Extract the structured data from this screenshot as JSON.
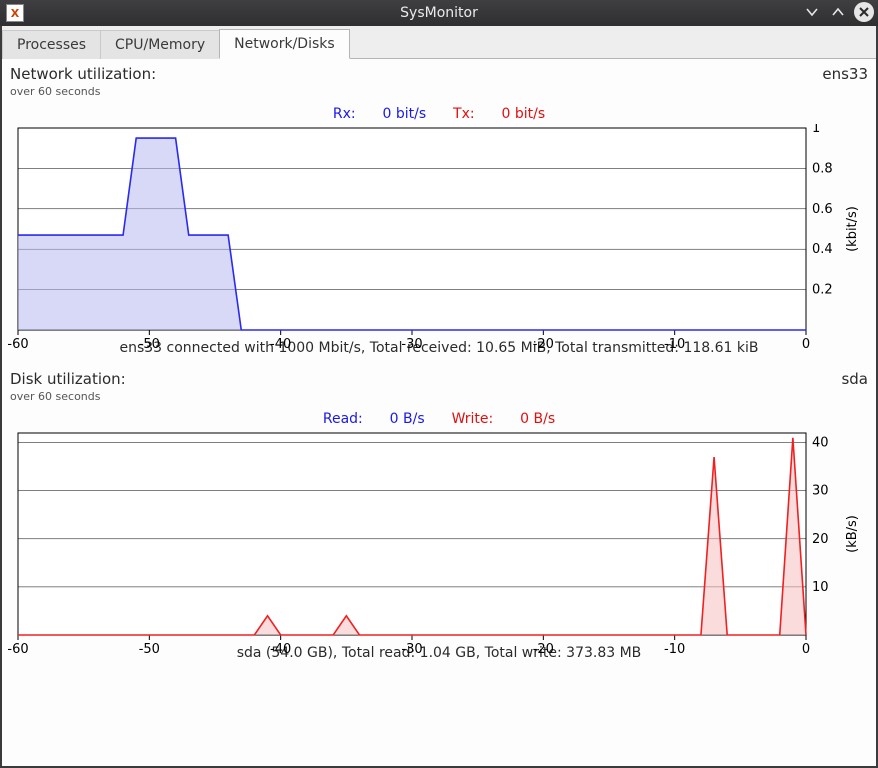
{
  "window": {
    "title": "SysMonitor",
    "app_icon_letter": "X"
  },
  "tabs": {
    "items": [
      {
        "label": "Processes",
        "active": false
      },
      {
        "label": "CPU/Memory",
        "active": false
      },
      {
        "label": "Network/Disks",
        "active": true
      }
    ]
  },
  "network": {
    "title": "Network utilization:",
    "device": "ens33",
    "subtitle": "over 60 seconds",
    "legend": {
      "rx_label": "Rx:",
      "rx_value": "0  bit/s",
      "tx_label": "Tx:",
      "tx_value": "0  bit/s"
    },
    "ylabel": "(kbit/s)",
    "caption": "ens33 connected with 1000 Mbit/s, Total received: 10.65 MiB, Total transmitted: 118.61 kiB"
  },
  "disk": {
    "title": "Disk utilization:",
    "device": "sda",
    "subtitle": "over 60 seconds",
    "legend": {
      "read_label": "Read:",
      "read_value": "0  B/s",
      "write_label": "Write:",
      "write_value": "0  B/s"
    },
    "ylabel": "(kB/s)",
    "caption": "sda (54.0 GB), Total read: 1.04 GB, Total write: 373.83 MB"
  },
  "chart_data": [
    {
      "id": "network",
      "type": "area",
      "x": [
        -60,
        -59,
        -58,
        -57,
        -56,
        -55,
        -54,
        -53,
        -52,
        -51,
        -50,
        -49,
        -48,
        -47,
        -46,
        -45,
        -44,
        -43,
        -42,
        -41,
        -40,
        -39,
        -38,
        -37,
        -36,
        -35,
        -34,
        -33,
        -32,
        -31,
        -30,
        -29,
        -28,
        -27,
        -26,
        -25,
        -24,
        -23,
        -22,
        -21,
        -20,
        -19,
        -18,
        -17,
        -16,
        -15,
        -14,
        -13,
        -12,
        -11,
        -10,
        -9,
        -8,
        -7,
        -6,
        -5,
        -4,
        -3,
        -2,
        -1,
        0
      ],
      "xlabel": "",
      "ylabel": "(kbit/s)",
      "xlim": [
        -60,
        0
      ],
      "ylim": [
        0,
        1.0
      ],
      "xticks": [
        -60,
        -50,
        -40,
        -30,
        -20,
        -10,
        0
      ],
      "yticks": [
        0.2,
        0.4,
        0.6,
        0.8,
        1.0
      ],
      "series": [
        {
          "name": "Rx",
          "color": "#2a2af0",
          "fill": "#b8b8f0",
          "values": [
            0.47,
            0.47,
            0.47,
            0.47,
            0.47,
            0.47,
            0.47,
            0.47,
            0.47,
            0.95,
            0.95,
            0.95,
            0.95,
            0.47,
            0.47,
            0.47,
            0.47,
            0,
            0,
            0,
            0,
            0,
            0,
            0,
            0,
            0,
            0,
            0,
            0,
            0,
            0,
            0,
            0,
            0,
            0,
            0,
            0,
            0,
            0,
            0,
            0,
            0,
            0,
            0,
            0,
            0,
            0,
            0,
            0,
            0,
            0,
            0,
            0,
            0,
            0,
            0,
            0,
            0,
            0,
            0,
            0
          ]
        },
        {
          "name": "Tx",
          "color": "#f02020",
          "fill": "#f6c0c0",
          "values": [
            0,
            0,
            0,
            0,
            0,
            0,
            0,
            0,
            0,
            0,
            0,
            0,
            0,
            0,
            0,
            0,
            0,
            0,
            0,
            0,
            0,
            0,
            0,
            0,
            0,
            0,
            0,
            0,
            0,
            0,
            0,
            0,
            0,
            0,
            0,
            0,
            0,
            0,
            0,
            0,
            0,
            0,
            0,
            0,
            0,
            0,
            0,
            0,
            0,
            0,
            0,
            0,
            0,
            0,
            0,
            0,
            0,
            0,
            0,
            0,
            0
          ]
        }
      ]
    },
    {
      "id": "disk",
      "type": "area",
      "x": [
        -60,
        -59,
        -58,
        -57,
        -56,
        -55,
        -54,
        -53,
        -52,
        -51,
        -50,
        -49,
        -48,
        -47,
        -46,
        -45,
        -44,
        -43,
        -42,
        -41,
        -40,
        -39,
        -38,
        -37,
        -36,
        -35,
        -34,
        -33,
        -32,
        -31,
        -30,
        -29,
        -28,
        -27,
        -26,
        -25,
        -24,
        -23,
        -22,
        -21,
        -20,
        -19,
        -18,
        -17,
        -16,
        -15,
        -14,
        -13,
        -12,
        -11,
        -10,
        -9,
        -8,
        -7,
        -6,
        -5,
        -4,
        -3,
        -2,
        -1,
        0
      ],
      "xlabel": "",
      "ylabel": "(kB/s)",
      "xlim": [
        -60,
        0
      ],
      "ylim": [
        0,
        42
      ],
      "xticks": [
        -60,
        -50,
        -40,
        -30,
        -20,
        -10,
        0
      ],
      "yticks": [
        10,
        20,
        30,
        40
      ],
      "series": [
        {
          "name": "Read",
          "color": "#2a2af0",
          "fill": "#b8b8f0",
          "values": [
            0,
            0,
            0,
            0,
            0,
            0,
            0,
            0,
            0,
            0,
            0,
            0,
            0,
            0,
            0,
            0,
            0,
            0,
            0,
            0,
            0,
            0,
            0,
            0,
            0,
            0,
            0,
            0,
            0,
            0,
            0,
            0,
            0,
            0,
            0,
            0,
            0,
            0,
            0,
            0,
            0,
            0,
            0,
            0,
            0,
            0,
            0,
            0,
            0,
            0,
            0,
            0,
            0,
            0,
            0,
            0,
            0,
            0,
            0,
            0,
            0
          ]
        },
        {
          "name": "Write",
          "color": "#f02020",
          "fill": "#f6c0c0",
          "values": [
            0,
            0,
            0,
            0,
            0,
            0,
            0,
            0,
            0,
            0,
            0,
            0,
            0,
            0,
            0,
            0,
            0,
            0,
            0,
            4,
            0,
            0,
            0,
            0,
            0,
            4,
            0,
            0,
            0,
            0,
            0,
            0,
            0,
            0,
            0,
            0,
            0,
            0,
            0,
            0,
            0,
            0,
            0,
            0,
            0,
            0,
            0,
            0,
            0,
            0,
            0,
            0,
            0,
            37,
            0,
            0,
            0,
            0,
            0,
            41,
            0
          ]
        }
      ]
    }
  ]
}
